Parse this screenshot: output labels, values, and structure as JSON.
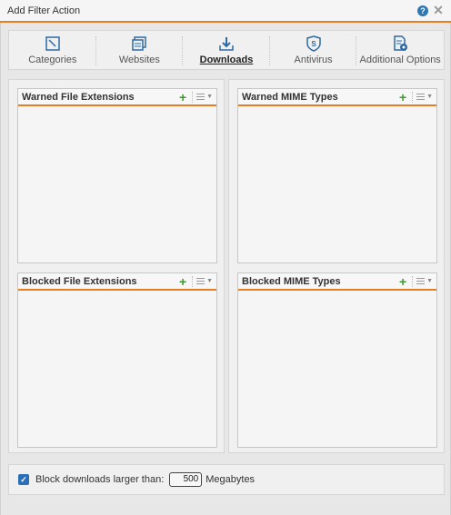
{
  "window": {
    "title": "Add Filter Action"
  },
  "tabs": [
    {
      "label": "Categories",
      "icon": "categories-icon",
      "active": false
    },
    {
      "label": "Websites",
      "icon": "websites-icon",
      "active": false
    },
    {
      "label": "Downloads",
      "icon": "download-icon",
      "active": true
    },
    {
      "label": "Antivirus",
      "icon": "antivirus-shield-icon",
      "active": false
    },
    {
      "label": "Additional Options",
      "icon": "additional-options-icon",
      "active": false
    }
  ],
  "panels": {
    "warned_ext": {
      "title": "Warned File Extensions"
    },
    "warned_mime": {
      "title": "Warned MIME Types"
    },
    "blocked_ext": {
      "title": "Blocked File Extensions"
    },
    "blocked_mime": {
      "title": "Blocked MIME Types"
    }
  },
  "footer": {
    "checkbox_checked": true,
    "label": "Block downloads larger than:",
    "size_value": "500",
    "unit": "Megabytes"
  },
  "colors": {
    "accent": "#e67e22",
    "add": "#3d9a2f",
    "checkbox": "#2a6fb7",
    "help": "#2d77b3"
  }
}
